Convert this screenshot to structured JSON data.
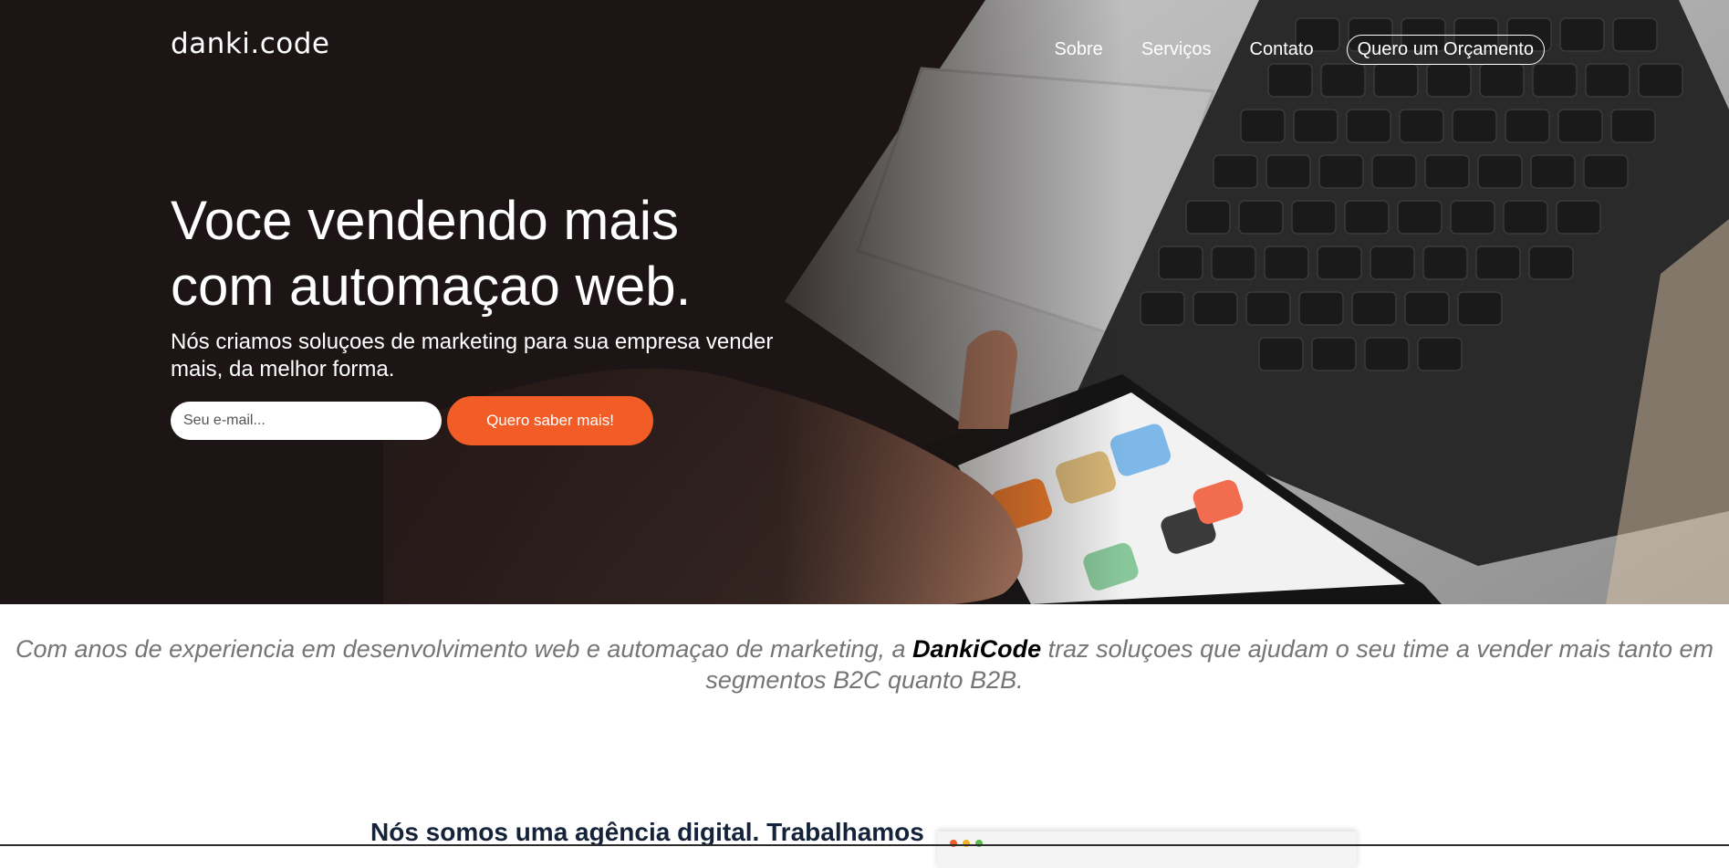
{
  "header": {
    "logo": "danki.code",
    "nav": [
      "Sobre",
      "Serviços",
      "Contato"
    ],
    "cta": "Quero um Orçamento"
  },
  "hero": {
    "title_line1": "Voce vendendo mais",
    "title_line2": "com automaçao web.",
    "subtitle": "Nós criamos soluçoes de marketing para sua empresa vender mais, da melhor forma.",
    "email_placeholder": "Seu e-mail...",
    "submit_label": "Quero saber mais!"
  },
  "intro": {
    "before": "Com anos de experiencia em desenvolvimento web e automaçao de marketing, a ",
    "brand": "DankiCode",
    "after": " traz soluçoes que ajudam o seu time a vender mais tanto em segmentos B2C quanto B2B."
  },
  "agency": {
    "text": "Nós somos uma agência digital. Trabalhamos"
  },
  "colors": {
    "accent": "#f25d27",
    "hero_bg": "#1d1515",
    "text_muted": "#757575",
    "heading_dark": "#15233a"
  },
  "icons": {
    "hero_image": "laptop-phone-photo",
    "window_dots": "window-controls-icon"
  }
}
